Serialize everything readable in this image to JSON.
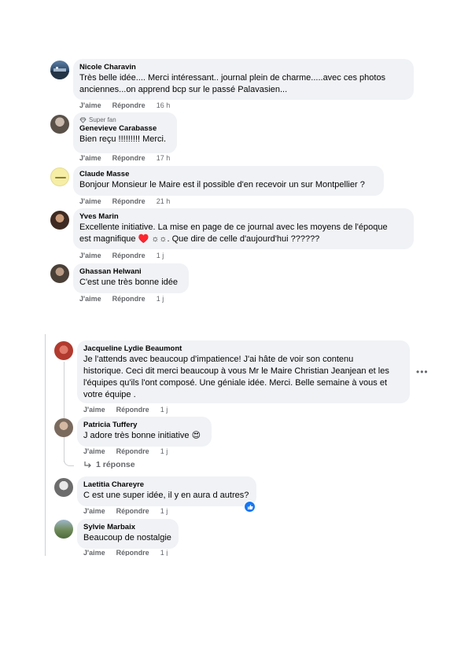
{
  "comments": [
    {
      "author": "Nicole Charavin",
      "text_line1": "Très belle idée.... Merci intéressant.. journal plein de charme.....avec ces photos",
      "text_line2": "anciennes...on apprend bcp sur le passé Palavasien...",
      "like": "J'aime",
      "reply": "Répondre",
      "time": "16 h"
    },
    {
      "badge": "Super fan",
      "author": "Genevieve Carabasse",
      "text_line1": "Bien reçu !!!!!!!!! Merci.",
      "like": "J'aime",
      "reply": "Répondre",
      "time": "17 h"
    },
    {
      "author": "Claude Masse",
      "text_line1": "Bonjour Monsieur le Maire est il possible d'en recevoir un sur Montpellier ?",
      "like": "J'aime",
      "reply": "Répondre",
      "time": "21 h"
    },
    {
      "author": "Yves Marin",
      "text_line1": "Excellente initiative. La mise en page de ce journal avec les moyens de l'époque",
      "text_line2": "est magnifique ♥️ ☼☼. Que dire de celle d'aujourd'hui ??????",
      "like": "J'aime",
      "reply": "Répondre",
      "time": "1 j"
    },
    {
      "author": "Ghassan Helwani",
      "text_line1": "C'est une très bonne idée",
      "like": "J'aime",
      "reply": "Répondre",
      "time": "1 j"
    }
  ],
  "thread": {
    "main": {
      "author": "Jacqueline Lydie Beaumont",
      "lines": [
        "Je l'attends avec beaucoup d'impatience! J'ai hâte de voir son contenu",
        "historique. Ceci dit merci beaucoup à vous Mr le Maire Christian Jeanjean et les",
        "l'équipes qu'ils l'ont composé. Une géniale idée. Merci. Belle semaine à vous et",
        "votre équipe ."
      ],
      "like": "J'aime",
      "reply": "Répondre",
      "time": "1 j"
    },
    "reply1": {
      "author": "Patricia Tuffery",
      "text": "J adore très bonne initiative 😍",
      "like": "J'aime",
      "reply": "Répondre",
      "time": "1 j",
      "replies_count": "1 réponse"
    },
    "reply2": {
      "author": "Laetitia Chareyre",
      "text": "C est une super idée, il y en aura d autres?",
      "like": "J'aime",
      "reply": "Répondre",
      "time": "1 j"
    },
    "reply3": {
      "author": "Sylvie Marbaix",
      "text": "Beaucoup de nostalgie",
      "like": "J'aime",
      "reply": "Répondre",
      "time": "1 j"
    }
  },
  "colors": {
    "bubble": "#f0f2f5",
    "secondary_text": "#65676b",
    "like_blue": "#1877f2"
  }
}
